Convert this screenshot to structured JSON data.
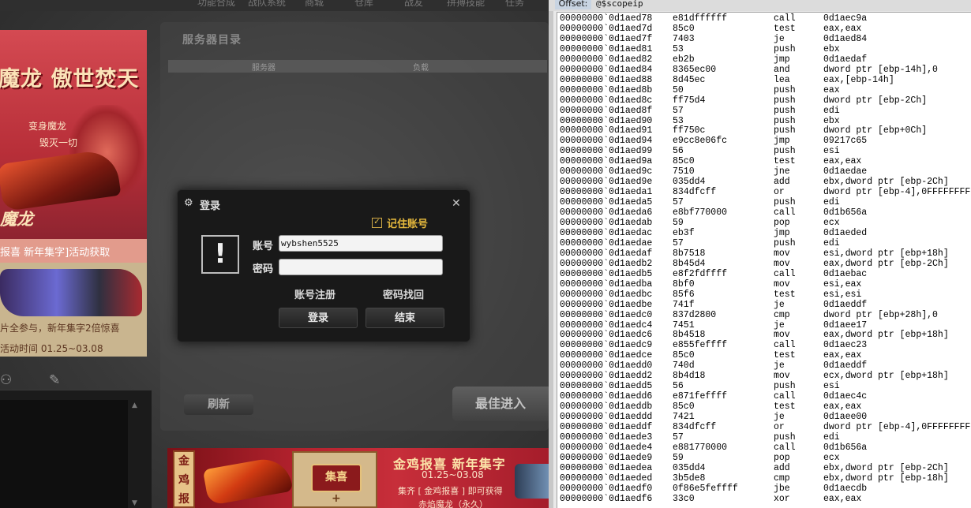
{
  "game": {
    "topnav": [
      "功能合成",
      "战队系统",
      "商城",
      "仓库",
      "战友",
      "拼搏技能",
      "任务"
    ],
    "banner": {
      "title": "魔龙 傲世焚天",
      "sub1": "变身魔龙",
      "sub2": "毁灭一切",
      "brand": "魔龙",
      "strip": "报喜 新年集字]活动获取",
      "line1": "片全参与，新年集字2倍惊喜",
      "line2": "活动时间 01.25~03.08"
    },
    "icons": [
      "friend-search-icon",
      "edit-icon"
    ],
    "server": {
      "title": "服务器目录",
      "col_server": "服务器",
      "col_load": "负载",
      "refresh": "刷新",
      "enter": "最佳进入"
    },
    "promo": {
      "side": [
        "金",
        "鸡",
        "报"
      ],
      "card": "集喜",
      "title": "金鸡报喜 新年集字",
      "date": "01.25~03.08",
      "desc": "集齐 [ 金鸡报喜 ] 即可获得",
      "desc2": "赤焰魔龙（永久）"
    }
  },
  "login": {
    "title": "登录",
    "remember_label": "记住账号",
    "remember_checked": true,
    "account_label": "账号",
    "account_value": "wybshen5525",
    "password_label": "密码",
    "password_value": "",
    "register": "账号注册",
    "recover": "密码找回",
    "login_button": "登录",
    "end_button": "结束"
  },
  "debugger": {
    "offset_label": "Offset:",
    "offset_expr": "@$scopeip",
    "rows": [
      [
        "00000000`0d1aed78",
        "e81dffffff",
        "call",
        "0d1aec9a"
      ],
      [
        "00000000`0d1aed7d",
        "85c0",
        "test",
        "eax,eax"
      ],
      [
        "00000000`0d1aed7f",
        "7403",
        "je",
        "0d1aed84"
      ],
      [
        "00000000`0d1aed81",
        "53",
        "push",
        "ebx"
      ],
      [
        "00000000`0d1aed82",
        "eb2b",
        "jmp",
        "0d1aedaf"
      ],
      [
        "00000000`0d1aed84",
        "8365ec00",
        "and",
        "dword ptr [ebp-14h],0"
      ],
      [
        "00000000`0d1aed88",
        "8d45ec",
        "lea",
        "eax,[ebp-14h]"
      ],
      [
        "00000000`0d1aed8b",
        "50",
        "push",
        "eax"
      ],
      [
        "00000000`0d1aed8c",
        "ff75d4",
        "push",
        "dword ptr [ebp-2Ch]"
      ],
      [
        "00000000`0d1aed8f",
        "57",
        "push",
        "edi"
      ],
      [
        "00000000`0d1aed90",
        "53",
        "push",
        "ebx"
      ],
      [
        "00000000`0d1aed91",
        "ff750c",
        "push",
        "dword ptr [ebp+0Ch]"
      ],
      [
        "00000000`0d1aed94",
        "e9cc8e06fc",
        "jmp",
        "09217c65"
      ],
      [
        "00000000`0d1aed99",
        "56",
        "push",
        "esi"
      ],
      [
        "00000000`0d1aed9a",
        "85c0",
        "test",
        "eax,eax"
      ],
      [
        "00000000`0d1aed9c",
        "7510",
        "jne",
        "0d1aedae"
      ],
      [
        "00000000`0d1aed9e",
        "035dd4",
        "add",
        "ebx,dword ptr [ebp-2Ch]"
      ],
      [
        "00000000`0d1aeda1",
        "834dfcff",
        "or",
        "dword ptr [ebp-4],0FFFFFFFFh"
      ],
      [
        "00000000`0d1aeda5",
        "57",
        "push",
        "edi"
      ],
      [
        "00000000`0d1aeda6",
        "e8bf770000",
        "call",
        "0d1b656a"
      ],
      [
        "00000000`0d1aedab",
        "59",
        "pop",
        "ecx"
      ],
      [
        "00000000`0d1aedac",
        "eb3f",
        "jmp",
        "0d1aeded"
      ],
      [
        "00000000`0d1aedae",
        "57",
        "push",
        "edi"
      ],
      [
        "00000000`0d1aedaf",
        "8b7518",
        "mov",
        "esi,dword ptr [ebp+18h]"
      ],
      [
        "00000000`0d1aedb2",
        "8b45d4",
        "mov",
        "eax,dword ptr [ebp-2Ch]"
      ],
      [
        "00000000`0d1aedb5",
        "e8f2fdffff",
        "call",
        "0d1aebac"
      ],
      [
        "00000000`0d1aedba",
        "8bf0",
        "mov",
        "esi,eax"
      ],
      [
        "00000000`0d1aedbc",
        "85f6",
        "test",
        "esi,esi"
      ],
      [
        "00000000`0d1aedbe",
        "741f",
        "je",
        "0d1aeddf"
      ],
      [
        "00000000`0d1aedc0",
        "837d2800",
        "cmp",
        "dword ptr [ebp+28h],0"
      ],
      [
        "00000000`0d1aedc4",
        "7451",
        "je",
        "0d1aee17"
      ],
      [
        "00000000`0d1aedc6",
        "8b4518",
        "mov",
        "eax,dword ptr [ebp+18h]"
      ],
      [
        "00000000`0d1aedc9",
        "e855feffff",
        "call",
        "0d1aec23"
      ],
      [
        "00000000`0d1aedce",
        "85c0",
        "test",
        "eax,eax"
      ],
      [
        "00000000`0d1aedd0",
        "740d",
        "je",
        "0d1aeddf"
      ],
      [
        "00000000`0d1aedd2",
        "8b4d18",
        "mov",
        "ecx,dword ptr [ebp+18h]"
      ],
      [
        "00000000`0d1aedd5",
        "56",
        "push",
        "esi"
      ],
      [
        "00000000`0d1aedd6",
        "e871feffff",
        "call",
        "0d1aec4c"
      ],
      [
        "00000000`0d1aeddb",
        "85c0",
        "test",
        "eax,eax"
      ],
      [
        "00000000`0d1aeddd",
        "7421",
        "je",
        "0d1aee00"
      ],
      [
        "00000000`0d1aeddf",
        "834dfcff",
        "or",
        "dword ptr [ebp-4],0FFFFFFFFh"
      ],
      [
        "00000000`0d1aede3",
        "57",
        "push",
        "edi"
      ],
      [
        "00000000`0d1aede4",
        "e881770000",
        "call",
        "0d1b656a"
      ],
      [
        "00000000`0d1aede9",
        "59",
        "pop",
        "ecx"
      ],
      [
        "00000000`0d1aedea",
        "035dd4",
        "add",
        "ebx,dword ptr [ebp-2Ch]"
      ],
      [
        "00000000`0d1aeded",
        "3b5de8",
        "cmp",
        "ebx,dword ptr [ebp-18h]"
      ],
      [
        "00000000`0d1aedf0",
        "0f86e5feffff",
        "jbe",
        "0d1aecdb"
      ],
      [
        "00000000`0d1aedf6",
        "33c0",
        "xor",
        "eax,eax"
      ]
    ]
  }
}
